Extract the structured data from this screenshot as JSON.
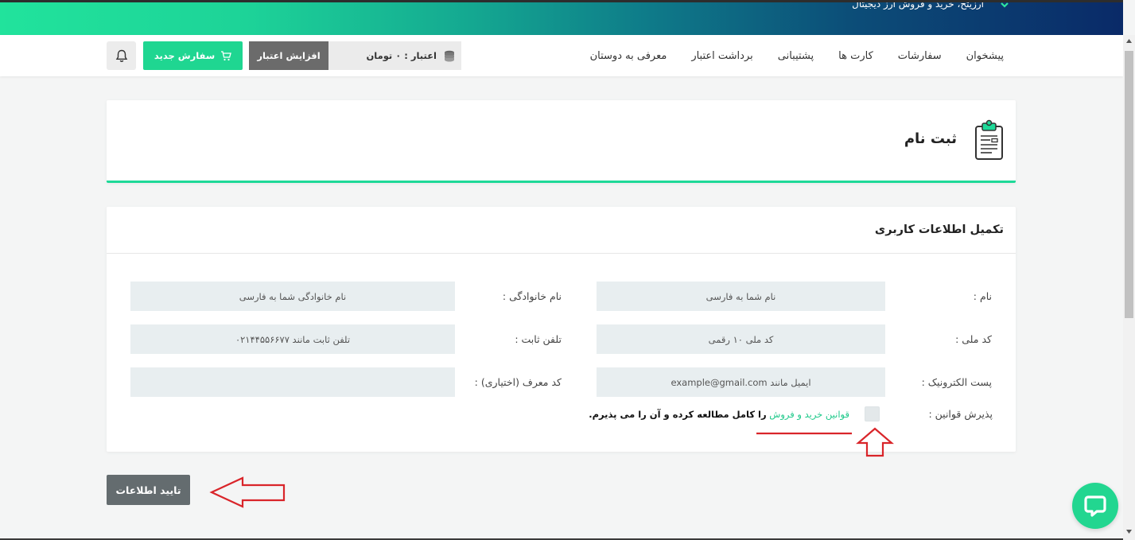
{
  "banner": {
    "tagline": "ارزیتخ، خرید و فروش ارز دیجیتال",
    "icon": "chevron-down-icon"
  },
  "nav": {
    "items": [
      "پیشخوان",
      "سفارشات",
      "کارت ها",
      "پشتیبانی",
      "برداشت اعتبار",
      "معرفی به دوستان"
    ]
  },
  "account": {
    "credit_label": "اعتبار : ۰ تومان",
    "increase_credit": "افزایش اعتبار",
    "new_order": "سفارش جدید",
    "icons": {
      "credit": "coins-icon",
      "new_order": "cart-icon",
      "notifications": "bell-icon"
    }
  },
  "page": {
    "title": "ثبت نام",
    "title_icon": "clipboard-icon"
  },
  "form": {
    "heading": "تکمیل اطلاعات کاربری",
    "fields": {
      "first_name": {
        "label": "نام :",
        "placeholder": "نام شما به فارسی",
        "value": ""
      },
      "last_name": {
        "label": "نام خانوادگی :",
        "placeholder": "نام خانوادگی شما به فارسی",
        "value": ""
      },
      "national_code": {
        "label": "کد ملی :",
        "placeholder": "کد ملی ۱۰ رقمی",
        "value": ""
      },
      "phone": {
        "label": "تلفن ثابت :",
        "placeholder": "تلفن ثابت مانند ۰۲۱۴۴۵۵۶۶۷۷",
        "value": ""
      },
      "email": {
        "label": "پست الکترونیک :",
        "placeholder": "ایمیل مانند example@gmail.com",
        "value": ""
      },
      "referral_code": {
        "label": "کد معرف (اختیاری) :",
        "placeholder": "",
        "value": ""
      }
    },
    "terms": {
      "label": "پذیرش قوانین :",
      "link": "قوانین خرید و فروش",
      "text": "را کامل مطالعه کرده و آن را می پذیرم.",
      "checked": false
    },
    "submit": "تایید اطلاعات"
  },
  "chat": {
    "icon": "chat-bubble-icon"
  },
  "colors": {
    "accent": "#1ed998",
    "brand_dark": "#0a2a68",
    "increase_button": "#6b6b6b",
    "submit_button": "#646c6f",
    "input_background": "#e8eef0",
    "link": "#1ec98a",
    "annotation": "#d9252a"
  }
}
